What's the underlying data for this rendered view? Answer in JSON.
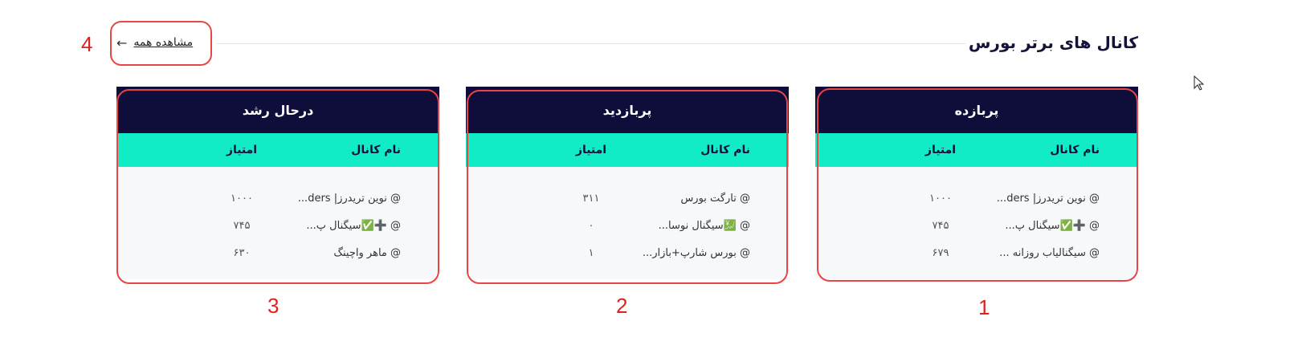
{
  "section": {
    "title": "کانال های برتر بورس",
    "see_all_label": "مشاهده همه",
    "see_all_arrow": "←"
  },
  "annotations": [
    "1",
    "2",
    "3",
    "4"
  ],
  "cards": [
    {
      "title": "پربازده",
      "col_name": "نام کانال",
      "col_score": "امتیاز",
      "rows": [
        {
          "name": "@ نوین تریدرز| ders...",
          "score": "۱۰۰۰"
        },
        {
          "name": "@ ➕✅سیگنال پ...",
          "score": "۷۴۵"
        },
        {
          "name": "@ سیگنالیاب روزانه ...",
          "score": "۶۷۹"
        }
      ]
    },
    {
      "title": "پربازدید",
      "col_name": "نام کانال",
      "col_score": "امتیاز",
      "rows": [
        {
          "name": "@ تارگت بورس",
          "score": "۳۱۱"
        },
        {
          "name": "@ 💹سیگنال نوسا...",
          "score": "۰"
        },
        {
          "name": "@ بورس شارپ+بازار...",
          "score": "۱"
        }
      ]
    },
    {
      "title": "درحال رشد",
      "col_name": "نام کانال",
      "col_score": "امتیاز",
      "rows": [
        {
          "name": "@ نوین تریدرز| ders...",
          "score": "۱۰۰۰"
        },
        {
          "name": "@ ➕✅سیگنال پ...",
          "score": "۷۴۵"
        },
        {
          "name": "@ ماهر واچینگ",
          "score": "۶۳۰"
        }
      ]
    }
  ]
}
